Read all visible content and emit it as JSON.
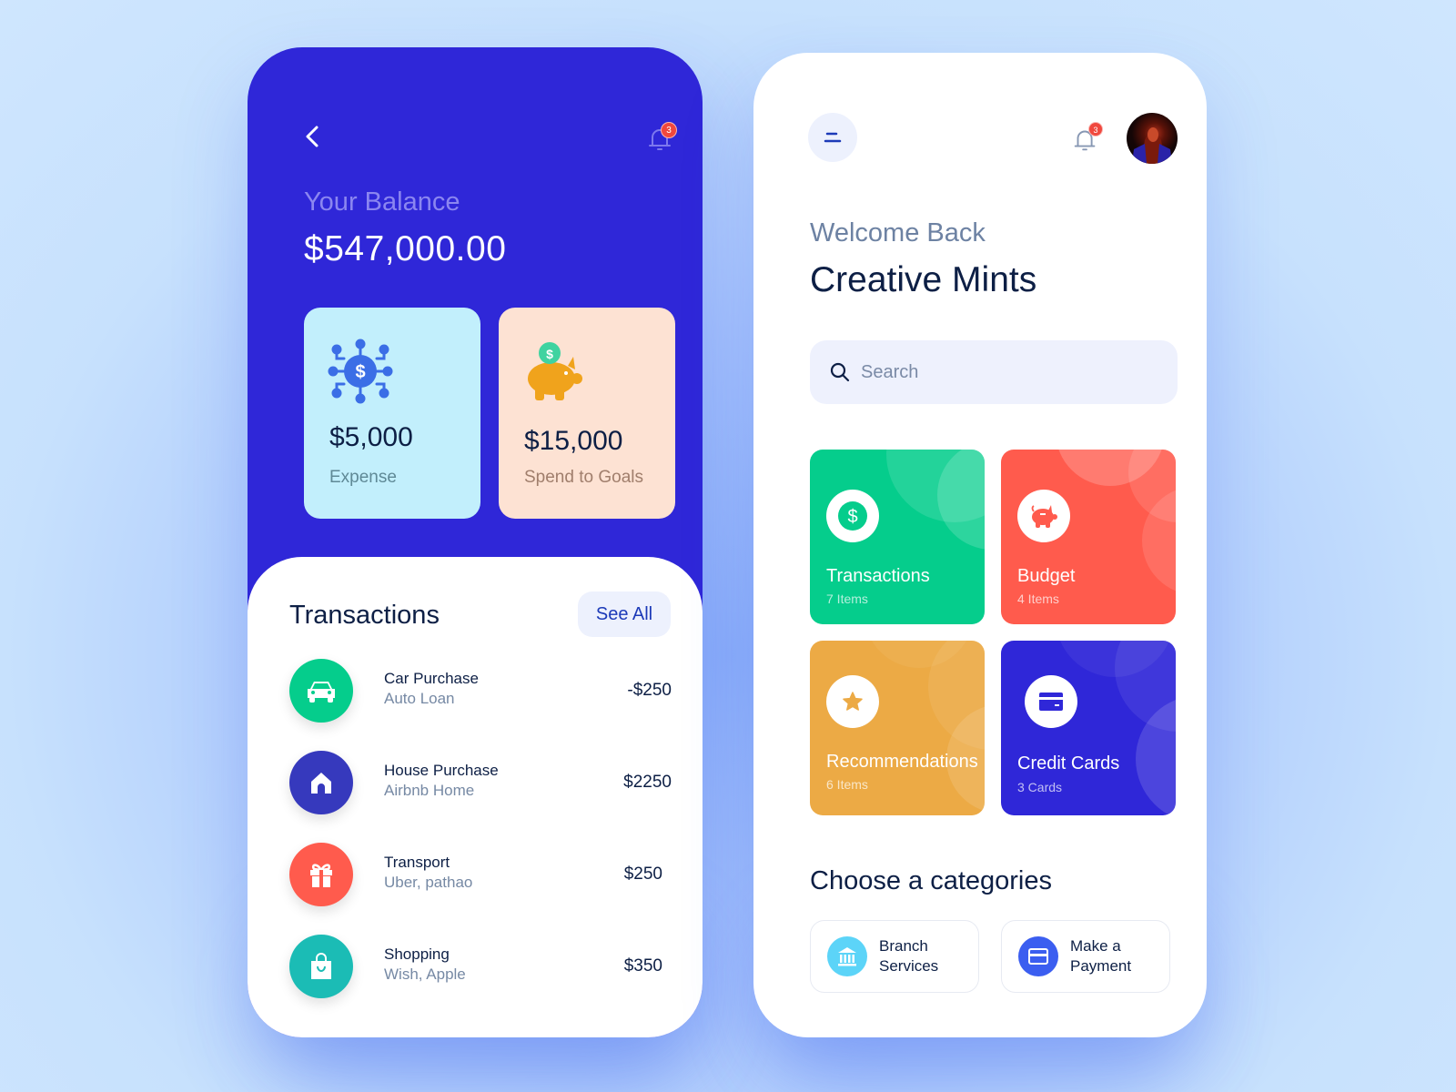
{
  "colors": {
    "primary": "#2f27d8",
    "dark_text": "#0d1f45",
    "muted_text": "#7689a4",
    "badge": "#f0483e",
    "green": "#05cd8c",
    "coral": "#ff5b4d",
    "amber": "#ecaa45",
    "teal": "#1bbcb5",
    "indigo": "#3639bd"
  },
  "left_screen": {
    "notification_count": "3",
    "balance_label": "Your Balance",
    "balance_value": "$547,000.00",
    "stats": [
      {
        "icon": "money-network-icon",
        "value": "$5,000",
        "label": "Expense"
      },
      {
        "icon": "piggy-bank-icon",
        "value": "$15,000",
        "label": "Spend to Goals"
      }
    ],
    "transactions_title": "Transactions",
    "see_all_label": "See All",
    "transactions": [
      {
        "icon": "car-icon",
        "name": "Car Purchase",
        "sub": "Auto Loan",
        "amount": "-$250"
      },
      {
        "icon": "home-icon",
        "name": "House Purchase",
        "sub": "Airbnb Home",
        "amount": "$2250"
      },
      {
        "icon": "gift-icon",
        "name": "Transport",
        "sub": "Uber, pathao",
        "amount": "$250"
      },
      {
        "icon": "shopping-bag-icon",
        "name": "Shopping",
        "sub": "Wish, Apple",
        "amount": "$350"
      }
    ]
  },
  "right_screen": {
    "notification_count": "3",
    "welcome": "Welcome Back",
    "user_name": "Creative Mints",
    "search": {
      "placeholder": "Search",
      "value": ""
    },
    "tiles": [
      {
        "icon": "dollar-icon",
        "title": "Transactions",
        "sub": "7 Items"
      },
      {
        "icon": "piggy-bank-icon",
        "title": "Budget",
        "sub": "4 Items"
      },
      {
        "icon": "star-icon",
        "title": "Recommendations",
        "sub": "6 Items"
      },
      {
        "icon": "credit-card-icon",
        "title": "Credit Cards",
        "sub": "3 Cards"
      }
    ],
    "categories_title": "Choose a categories",
    "categories": [
      {
        "icon": "bank-icon",
        "line1": "Branch",
        "line2": "Services"
      },
      {
        "icon": "card-icon",
        "line1": "Make a",
        "line2": "Payment"
      }
    ]
  }
}
